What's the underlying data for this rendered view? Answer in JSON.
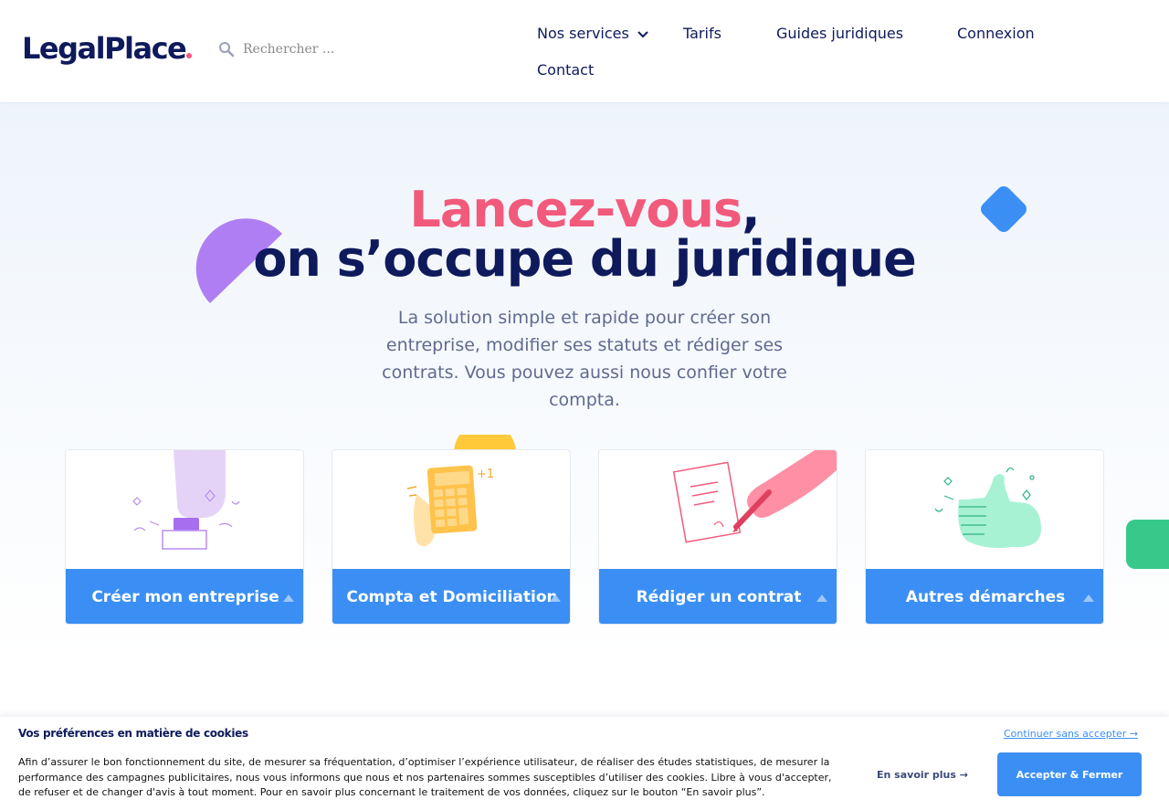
{
  "header": {
    "logo_text": "LegalPlace",
    "search_placeholder": "Rechercher ...",
    "nav": {
      "services": "Nos services",
      "tarifs": "Tarifs",
      "guides": "Guides juridiques",
      "connexion": "Connexion",
      "contact": "Contact"
    }
  },
  "hero": {
    "title_highlight": "Lancez-vous",
    "title_comma": ",",
    "title_line2": "on s’occupe du juridique",
    "subtitle": "La solution simple et rapide pour créer son entreprise, modifier ses statuts et rédiger ses contrats. Vous pouvez aussi nous confier votre compta."
  },
  "cards": [
    {
      "label": "Créer mon entreprise"
    },
    {
      "label": "Compta et Domiciliation"
    },
    {
      "label": "Rédiger un contrat"
    },
    {
      "label": "Autres démarches"
    }
  ],
  "colors": {
    "brand_navy": "#0f1a5c",
    "accent_pink": "#f25a7c",
    "button_blue": "#3b8ff4",
    "deco_purple": "#b07ef3",
    "deco_yellow": "#ffc93a",
    "side_green": "#37c98a"
  },
  "cookie": {
    "title": "Vos préférences en matière de cookies",
    "text": "Afin d’assurer le bon fonctionnement du site, de mesurer sa fréquentation, d’optimiser l’expérience utilisateur, de réaliser des études statistiques, de mesurer la performance des campagnes publicitaires, nous vous informons que nous et nos partenaires sommes susceptibles d’utiliser des cookies. Libre à vous d'accepter, de refuser et de changer d'avis à tout moment. Pour en savoir plus concernant le traitement de vos données, cliquez sur le bouton “En savoir plus”.",
    "continue_label": "Continuer sans accepter →",
    "more_label": "En savoir plus →",
    "accept_label": "Accepter & Fermer"
  }
}
